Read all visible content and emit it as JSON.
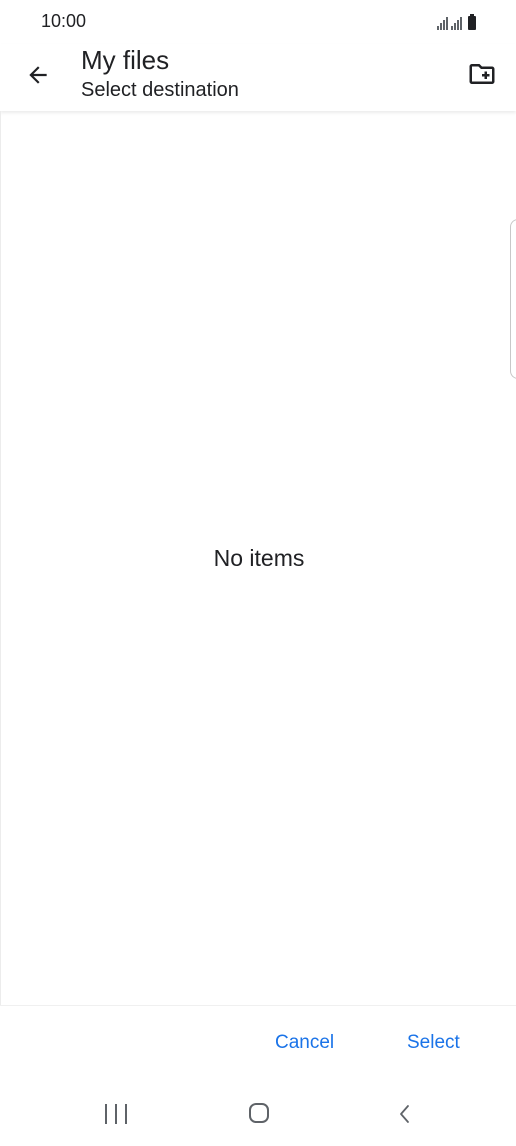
{
  "status_bar": {
    "time": "10:00",
    "icons": [
      "signal-icon",
      "signal-icon",
      "battery-icon"
    ]
  },
  "app_bar": {
    "title": "My files",
    "subtitle": "Select destination",
    "back_icon": "arrow-back-icon",
    "new_folder_icon": "create-new-folder-icon"
  },
  "content": {
    "empty_message": "No items"
  },
  "actions": {
    "cancel_label": "Cancel",
    "select_label": "Select"
  },
  "colors": {
    "accent": "#1a73e8",
    "text": "#202124",
    "icon": "#5f6368",
    "background": "#ffffff"
  },
  "nav_bar": {
    "icons": [
      "recent-apps-icon",
      "home-icon",
      "back-icon"
    ]
  }
}
